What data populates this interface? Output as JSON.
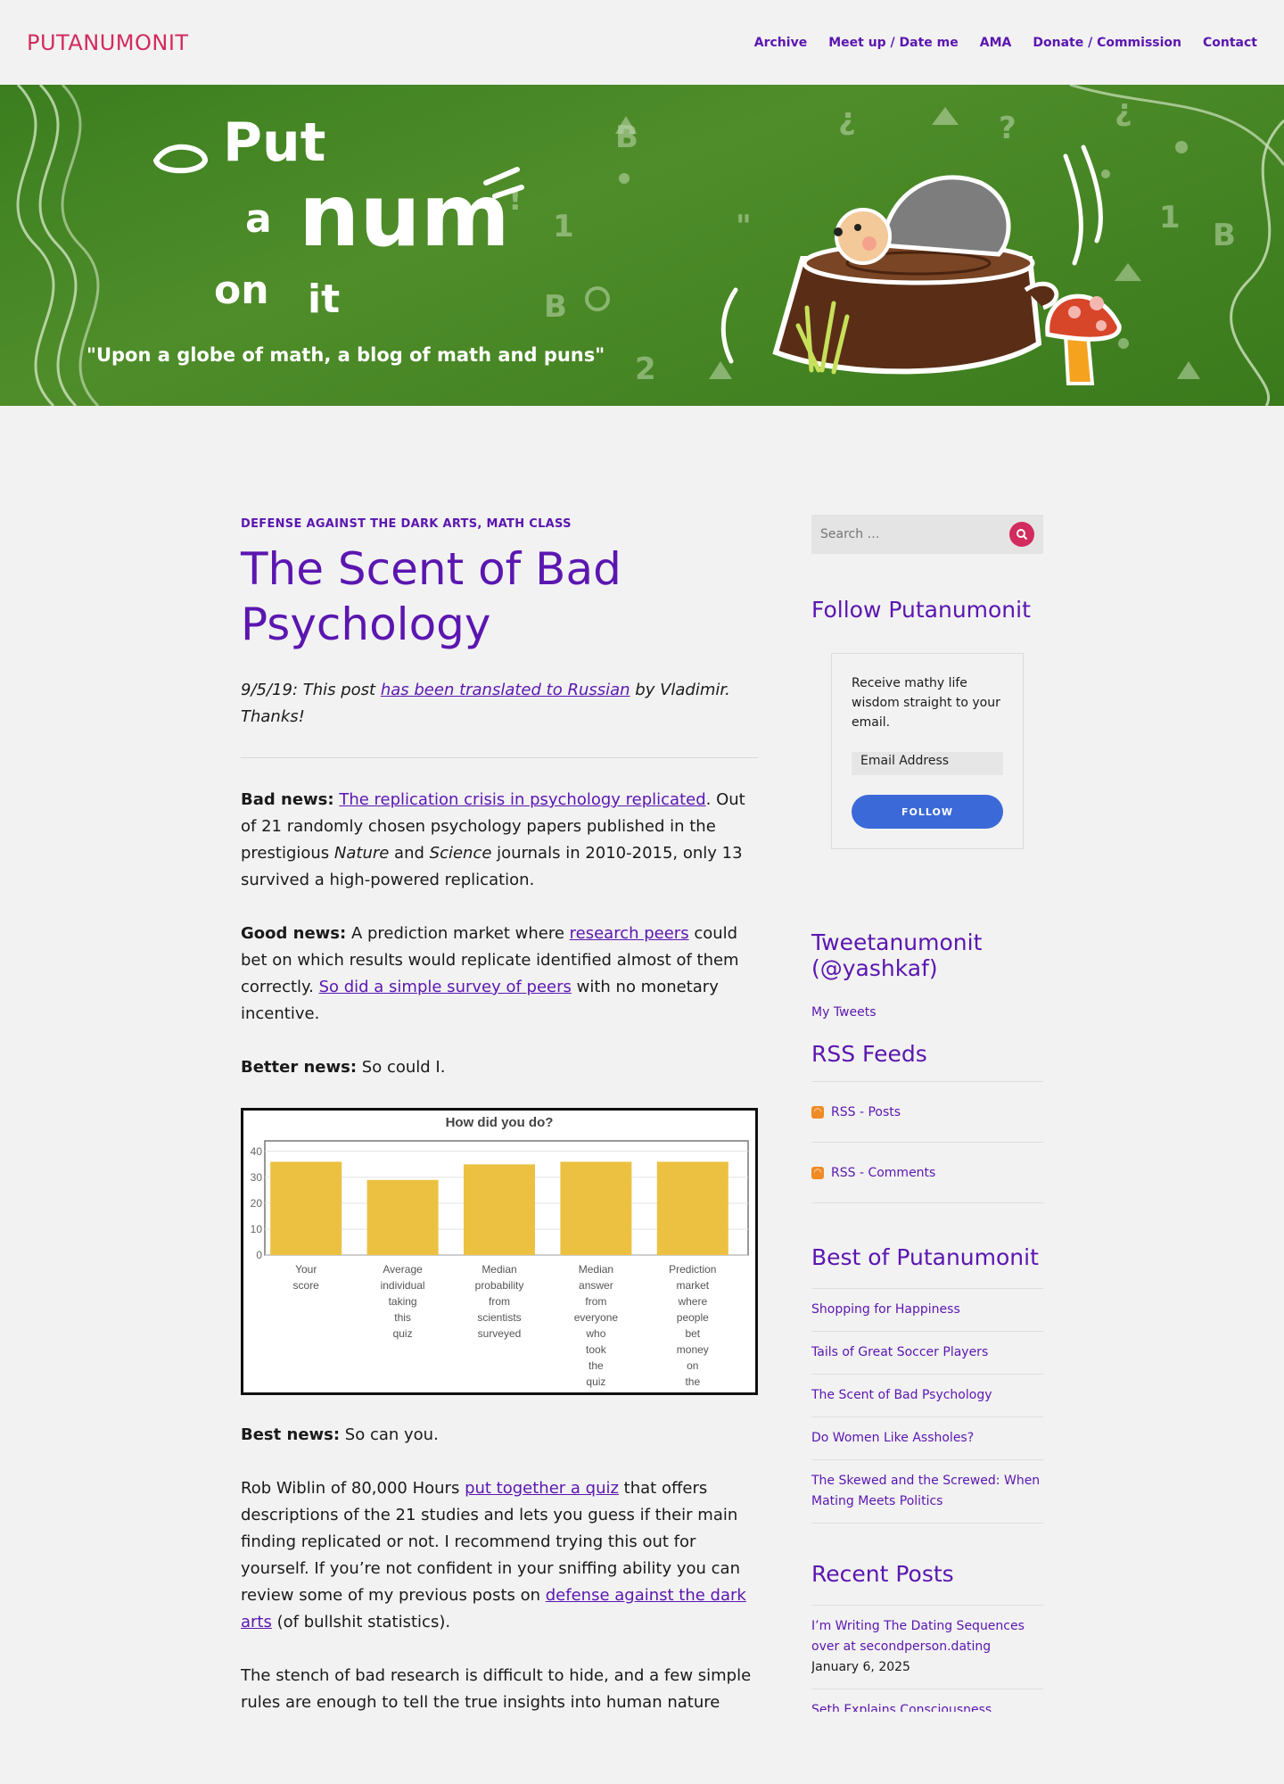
{
  "site": {
    "title": "PUTANUMONIT"
  },
  "nav": [
    "Archive",
    "Meet up / Date me",
    "AMA",
    "Donate / Commission",
    "Contact"
  ],
  "banner": {
    "line1": "Put",
    "line2a": "a",
    "line2b": "num",
    "line3a": "on",
    "line3b": "it",
    "tagline": "\"Upon a globe of math, a blog of math and puns\"",
    "colors": {
      "bg": "#3b7e1f",
      "stump": "#5a2e16",
      "mushroom": "#d8462a"
    }
  },
  "post": {
    "categories": [
      "DEFENSE AGAINST THE DARK ARTS",
      "MATH CLASS"
    ],
    "title": "The Scent of Bad Psychology",
    "intro": {
      "pre": "9/5/19: This post ",
      "link": "has been translated to Russian",
      "post": " by Vladimir. Thanks!"
    },
    "p1": {
      "bold": "Bad news:",
      "link": "The replication crisis in psychology replicated",
      "rest": ". Out of 21 randomly chosen psychology papers published in the prestigious ",
      "i1": "Nature",
      "and": " and ",
      "i2": "Science",
      "tail": " journals in 2010-2015, only 13 survived a high-powered replication."
    },
    "p2": {
      "bold": "Good news:",
      "pre": " A prediction market where ",
      "link1": "research peers",
      "mid": " could bet on which results would replicate identified almost of them correctly. ",
      "link2": "So did a simple survey of peers",
      "tail": " with no monetary incentive."
    },
    "p3": {
      "bold": "Better news:",
      "rest": " So could I."
    },
    "p4": {
      "bold": "Best news:",
      "rest": " So can you."
    },
    "p5": {
      "pre": "Rob Wiblin of 80,000 Hours ",
      "link1": "put together a quiz",
      "mid": " that offers descriptions of the 21 studies and lets you guess if their main finding replicated or not. I recommend trying this out for yourself. If you’re not confident in your sniffing ability you can review some of my previous posts on ",
      "link2": "defense against the dark arts",
      "tail": " (of bullshit statistics)."
    },
    "p6": "The stench of bad research is difficult to hide, and a few simple rules are enough to tell the true insights into human nature from the"
  },
  "chart_data": {
    "type": "bar",
    "title": "How did you do?",
    "categories": [
      "Your score",
      "Average individual taking this quiz",
      "Median probability from scientists surveyed",
      "Median answer from everyone who took the quiz",
      "Prediction market where people bet money on the outcomes"
    ],
    "values": [
      36,
      29,
      35,
      36,
      36
    ],
    "yticks": [
      "0",
      "10",
      "20",
      "30",
      "40"
    ],
    "ylim": [
      0,
      42
    ],
    "bar_color": "#ecc142",
    "grid": true
  },
  "sidebar": {
    "search_placeholder": "Search …",
    "follow_title": "Follow Putanumonit",
    "follow_text": "Receive mathy life wisdom straight to your email.",
    "email_placeholder": "Email Address",
    "follow_button": "FOLLOW",
    "tweet_title": "Tweetanumonit (@yashkaf)",
    "my_tweets": "My Tweets",
    "rss_title": "RSS Feeds",
    "rss_posts": "RSS - Posts",
    "rss_comments": "RSS - Comments",
    "best_title": "Best of Putanumonit",
    "best": [
      "Shopping for Happiness",
      "Tails of Great Soccer Players",
      "The Scent of Bad Psychology",
      "Do Women Like Assholes?",
      "The Skewed and the Screwed: When Mating Meets Politics"
    ],
    "recent_title": "Recent Posts",
    "recent": [
      {
        "title": "I’m Writing The Dating Sequences over at secondperson.dating",
        "date": "January 6, 2025"
      },
      {
        "title": "Seth Explains Consciousness",
        "date": ""
      }
    ]
  }
}
